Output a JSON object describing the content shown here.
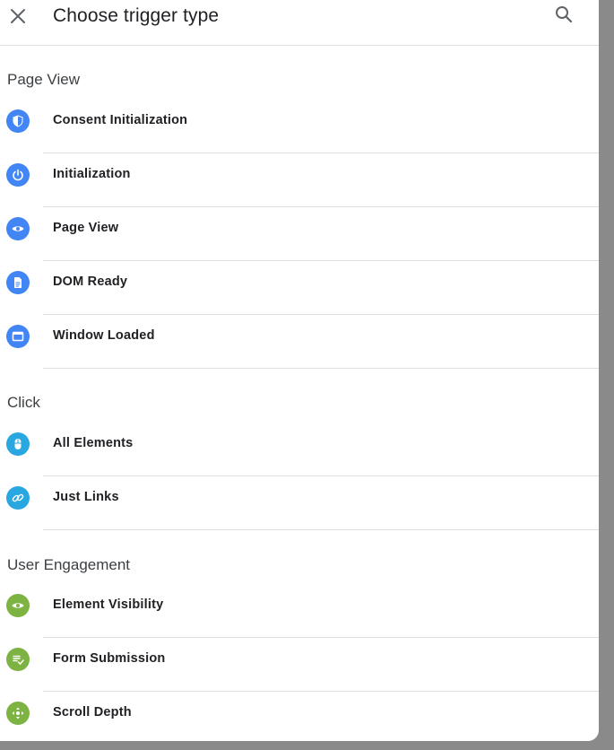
{
  "header": {
    "title": "Choose trigger type",
    "close_icon": "close-icon",
    "search_icon": "search-icon"
  },
  "sections": [
    {
      "title": "Page View",
      "items": [
        {
          "label": "Consent Initialization",
          "icon": "shield-icon",
          "color": "#4285f4"
        },
        {
          "label": "Initialization",
          "icon": "power-icon",
          "color": "#4285f4"
        },
        {
          "label": "Page View",
          "icon": "eye-icon",
          "color": "#4285f4"
        },
        {
          "label": "DOM Ready",
          "icon": "document-icon",
          "color": "#4285f4"
        },
        {
          "label": "Window Loaded",
          "icon": "window-icon",
          "color": "#4285f4"
        }
      ]
    },
    {
      "title": "Click",
      "items": [
        {
          "label": "All Elements",
          "icon": "mouse-icon",
          "color": "#29a7e1"
        },
        {
          "label": "Just Links",
          "icon": "link-icon",
          "color": "#29a7e1"
        }
      ]
    },
    {
      "title": "User Engagement",
      "items": [
        {
          "label": "Element Visibility",
          "icon": "eye-icon",
          "color": "#7cb342"
        },
        {
          "label": "Form Submission",
          "icon": "form-icon",
          "color": "#7cb342"
        },
        {
          "label": "Scroll Depth",
          "icon": "scroll-icon",
          "color": "#7cb342"
        }
      ]
    }
  ]
}
